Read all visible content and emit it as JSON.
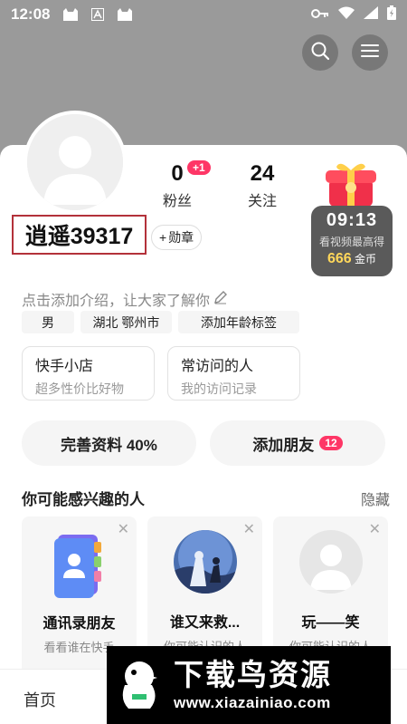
{
  "status_bar": {
    "time": "12:08"
  },
  "profile": {
    "fans_count": "0",
    "fans_new": "+1",
    "fans_label": "粉丝",
    "following_count": "24",
    "following_label": "关注",
    "username": "逍遥39317",
    "medal_label": "勋章",
    "intro_placeholder": "点击添加介绍，让大家了解你",
    "tags": [
      "男",
      "湖北 鄂州市",
      "添加年龄标签"
    ]
  },
  "reward": {
    "timer": "09:13",
    "caption": "看视频最高得",
    "amount": "666",
    "unit": "金币"
  },
  "quick_links": [
    {
      "title": "快手小店",
      "subtitle": "超多性价比好物"
    },
    {
      "title": "常访问的人",
      "subtitle": "我的访问记录"
    }
  ],
  "actions": {
    "complete_profile": "完善资料 40%",
    "add_friends": "添加朋友",
    "add_friends_count": "12"
  },
  "recommend": {
    "title": "你可能感兴趣的人",
    "hide_label": "隐藏",
    "cards": [
      {
        "name": "通讯录朋友",
        "sub": "看看谁在快手"
      },
      {
        "name": "谁又来救...",
        "sub": "你可能认识的人"
      },
      {
        "name": "玩——笑",
        "sub": "你可能认识的人"
      }
    ]
  },
  "tabbar": {
    "home_label": "首页"
  },
  "watermark": {
    "title": "下载鸟资源",
    "url": "www.xiazainiao.com"
  },
  "colors": {
    "accent": "#fe3666",
    "highlight_border": "#b3313a",
    "coin": "#ffd75a"
  }
}
